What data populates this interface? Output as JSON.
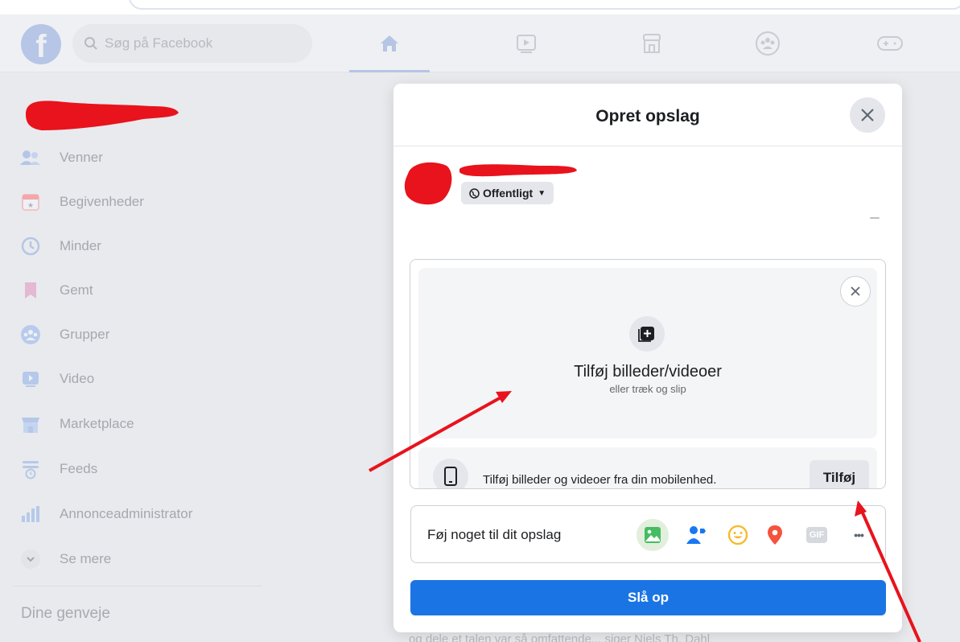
{
  "search": {
    "placeholder": "Søg på Facebook"
  },
  "sidebar": {
    "items": [
      {
        "label": "Venner",
        "icon": "friends-icon"
      },
      {
        "label": "Begivenheder",
        "icon": "calendar-icon"
      },
      {
        "label": "Minder",
        "icon": "memories-icon"
      },
      {
        "label": "Gemt",
        "icon": "bookmark-icon"
      },
      {
        "label": "Grupper",
        "icon": "groups-icon"
      },
      {
        "label": "Video",
        "icon": "video-icon"
      },
      {
        "label": "Marketplace",
        "icon": "marketplace-icon"
      },
      {
        "label": "Feeds",
        "icon": "feeds-icon"
      },
      {
        "label": "Annonceadministrator",
        "icon": "ads-manager-icon"
      },
      {
        "label": "Se mere",
        "icon": "chevron-down-icon"
      }
    ],
    "shortcuts_title": "Dine genveje"
  },
  "feed": {
    "bottom_text": "og dele et talen var så omfattende... siger Niels Th. Dahl"
  },
  "modal": {
    "title": "Opret opslag",
    "audience": "Offentligt",
    "media": {
      "title": "Tilføj billeder/videoer",
      "subtitle": "eller træk og slip",
      "mobile_text": "Tilføj billeder og videoer fra din mobilenhed.",
      "mobile_button": "Tilføj"
    },
    "add_to_post": {
      "label": "Føj noget til dit opslag",
      "gif_label": "GIF",
      "more_label": "•••"
    },
    "post_button": "Slå op"
  },
  "colors": {
    "primary": "#1b74e4",
    "redaction": "#e8131c",
    "arrow": "#e8131c",
    "photo_green": "#45bd62",
    "tag_blue": "#1877f2",
    "feeling_yellow": "#f7b928",
    "location_red": "#f5533d"
  }
}
